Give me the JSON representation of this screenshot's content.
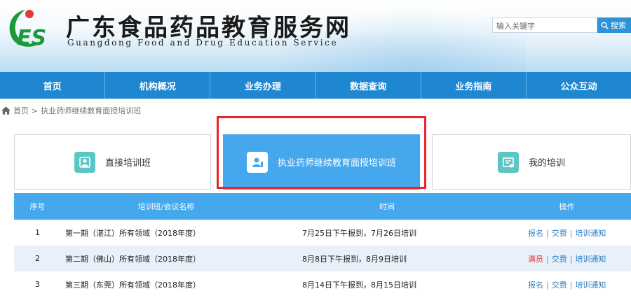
{
  "header": {
    "logo_text": "ES",
    "site_title": "广东食品药品教育服务网",
    "site_subtitle": "Guangdong Food and Drug Education Service",
    "search": {
      "placeholder": "输入关键字",
      "button_label": "搜索"
    }
  },
  "nav": {
    "items": [
      {
        "label": "首页"
      },
      {
        "label": "机构概况"
      },
      {
        "label": "业务办理"
      },
      {
        "label": "数据查询"
      },
      {
        "label": "业务指南"
      },
      {
        "label": "公众互动"
      }
    ]
  },
  "breadcrumb": {
    "home": "首页",
    "separator": ">",
    "current": "执业药师继续教育面授培训班"
  },
  "cards": [
    {
      "label": "直接培训班",
      "icon": "edit-icon",
      "active": false
    },
    {
      "label": "执业药师继续教育面授培训班",
      "icon": "person-icon",
      "active": true
    },
    {
      "label": "我的培训",
      "icon": "certificate-icon",
      "active": false
    }
  ],
  "table": {
    "headers": {
      "no": "序号",
      "name": "培训班/会议名称",
      "time": "时间",
      "op": "操作"
    },
    "rows": [
      {
        "no": "1",
        "name": "第一期（湛江）所有领域（2018年度）",
        "time": "7月25日下午报到，7月26日培训",
        "op1": "报名",
        "op2": "交费",
        "op3": "培训通知",
        "op1_status": "normal"
      },
      {
        "no": "2",
        "name": "第二期（佛山）所有领域（2018年度）",
        "time": "8月8日下午报到，8月9日培训",
        "op1": "满员",
        "op2": "交费",
        "op3": "培训通知",
        "op1_status": "full"
      },
      {
        "no": "3",
        "name": "第三期（东莞）所有领域（2018年度）",
        "time": "8月14日下午报到，8月15日培训",
        "op1": "报名",
        "op2": "交费",
        "op3": "培训通知",
        "op1_status": "normal"
      }
    ]
  },
  "colors": {
    "primary": "#1f86d1",
    "accent": "#45a7ec",
    "highlight": "#e8252a",
    "logo_green": "#1b9a3a"
  }
}
